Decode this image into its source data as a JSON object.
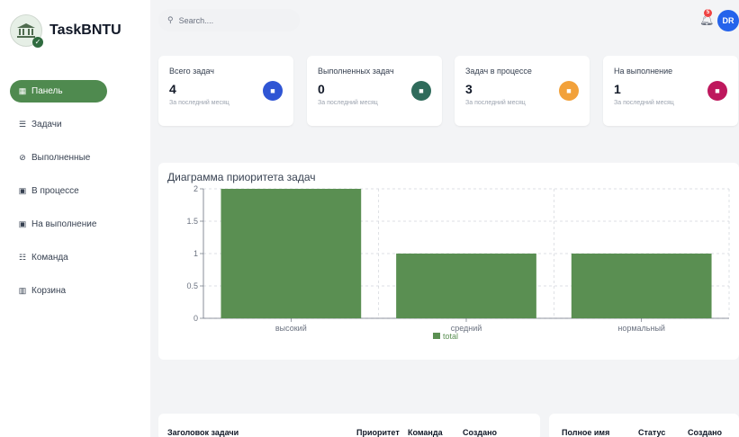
{
  "app": {
    "name": "TaskBNTU"
  },
  "sidebar": {
    "items": [
      {
        "label": "Панель",
        "icon": "dashboard-icon",
        "glyph": "▦",
        "active": true
      },
      {
        "label": "Задачи",
        "icon": "tasks-icon",
        "glyph": "☰",
        "active": false
      },
      {
        "label": "Выполненные",
        "icon": "check-circle-icon",
        "glyph": "⊘",
        "active": false
      },
      {
        "label": "В процессе",
        "icon": "clipboard-icon",
        "glyph": "▣",
        "active": false
      },
      {
        "label": "На выполнение",
        "icon": "clipboard-icon",
        "glyph": "▣",
        "active": false
      },
      {
        "label": "Команда",
        "icon": "team-icon",
        "glyph": "☷",
        "active": false
      },
      {
        "label": "Корзина",
        "icon": "trash-icon",
        "glyph": "▥",
        "active": false
      }
    ]
  },
  "header": {
    "search_placeholder": "Search....",
    "notifications_count": "5",
    "avatar_initials": "DR"
  },
  "stats": [
    {
      "label": "Всего задач",
      "value": "4",
      "sub": "За последний месяц",
      "icon": "total-tasks-icon",
      "color": "#2f55d4"
    },
    {
      "label": "Выполненных задач",
      "value": "0",
      "sub": "За последний месяц",
      "icon": "completed-icon",
      "color": "#2f6b5b"
    },
    {
      "label": "Задач в процессе",
      "value": "3",
      "sub": "За последний месяц",
      "icon": "in-progress-icon",
      "color": "#f2a13a"
    },
    {
      "label": "На выполнение",
      "value": "1",
      "sub": "За последний месяц",
      "icon": "todo-icon",
      "color": "#be185d"
    }
  ],
  "chart_data": {
    "type": "bar",
    "title": "Диаграмма приоритета задач",
    "categories": [
      "высокий",
      "средний",
      "нормальный"
    ],
    "series": [
      {
        "name": "total",
        "values": [
          2,
          1,
          1
        ],
        "color": "#5a8f52"
      }
    ],
    "ylim": [
      0,
      2
    ],
    "yticks": [
      "0",
      "0.5",
      "1",
      "1.5",
      "2"
    ],
    "ytick_values": [
      0,
      0.5,
      1,
      1.5,
      2
    ],
    "grid": true,
    "legend": "bottom"
  },
  "tasks_table": {
    "headers": [
      "Заголовок задачи",
      "Приоритет",
      "Команда",
      "Создано"
    ]
  },
  "users_table": {
    "headers": [
      "Полное имя",
      "Статус",
      "Создано"
    ]
  }
}
